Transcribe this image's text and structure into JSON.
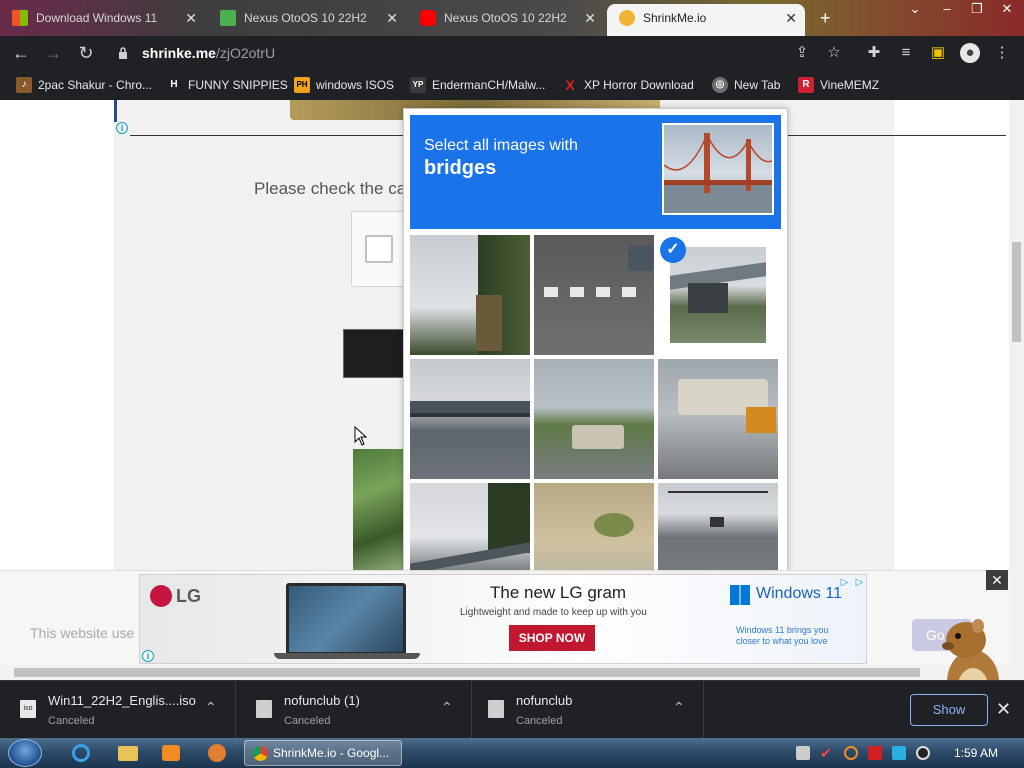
{
  "browser": {
    "tabs": [
      {
        "title": "Download Windows 11",
        "active": false
      },
      {
        "title": "Nexus OtoOS 10 22H2",
        "active": false
      },
      {
        "title": "Nexus OtoOS 10 22H2",
        "active": false
      },
      {
        "title": "ShrinkMe.io",
        "active": true
      }
    ],
    "new_tab_symbol": "+",
    "url_domain": "shrinke.me",
    "url_path": "/zjO2otrU",
    "bookmarks": [
      {
        "label": "2pac Shakur - Chro...",
        "icon": "music-icon",
        "color": "#8a5a2b"
      },
      {
        "label": "FUNNY SNIPPIES",
        "icon": "h-logo-icon",
        "color": "#ffffff",
        "glyph": "H"
      },
      {
        "label": "windows ISOS",
        "icon": "ph-logo-icon",
        "color": "#f0a21b",
        "glyph": "PH"
      },
      {
        "label": "EndermanCH/Malw...",
        "icon": "yp-logo-icon",
        "color": "#3a3a3a",
        "glyph": "YP"
      },
      {
        "label": "XP Horror Download",
        "icon": "x-logo-icon",
        "color": "#d02020",
        "glyph": "X"
      },
      {
        "label": "New Tab",
        "icon": "globe-icon",
        "color": "#6f6f6f",
        "glyph": "◎"
      },
      {
        "label": "VineMEMZ",
        "icon": "r-logo-icon",
        "color": "#d02030",
        "glyph": "R"
      }
    ]
  },
  "page": {
    "check_prompt": "Please check the ca"
  },
  "captcha": {
    "instruction": "Select all images with",
    "target": "bridges",
    "selected_tile": 2
  },
  "ad": {
    "brand": "LG",
    "headline": "The new LG gram",
    "subline": "Lightweight and made to keep up with you",
    "cta": "SHOP NOW",
    "win_brand": "Windows 11",
    "win_copy": "Windows 11 brings you closer to what you love"
  },
  "cookie": {
    "text": "This website use",
    "button": "Go"
  },
  "downloads": [
    {
      "name": "Win11_22H2_Englis....iso",
      "status": "Canceled"
    },
    {
      "name": "nofunclub (1)",
      "status": "Canceled"
    },
    {
      "name": "nofunclub",
      "status": "Canceled"
    }
  ],
  "downloads_show_all": "Show",
  "taskbar": {
    "active_window": "ShrinkMe.io - Googl...",
    "clock": "1:59 AM"
  },
  "colors": {
    "captcha_blue": "#1a73e8",
    "chrome_dark": "#202124",
    "cta_red": "#c01830"
  }
}
